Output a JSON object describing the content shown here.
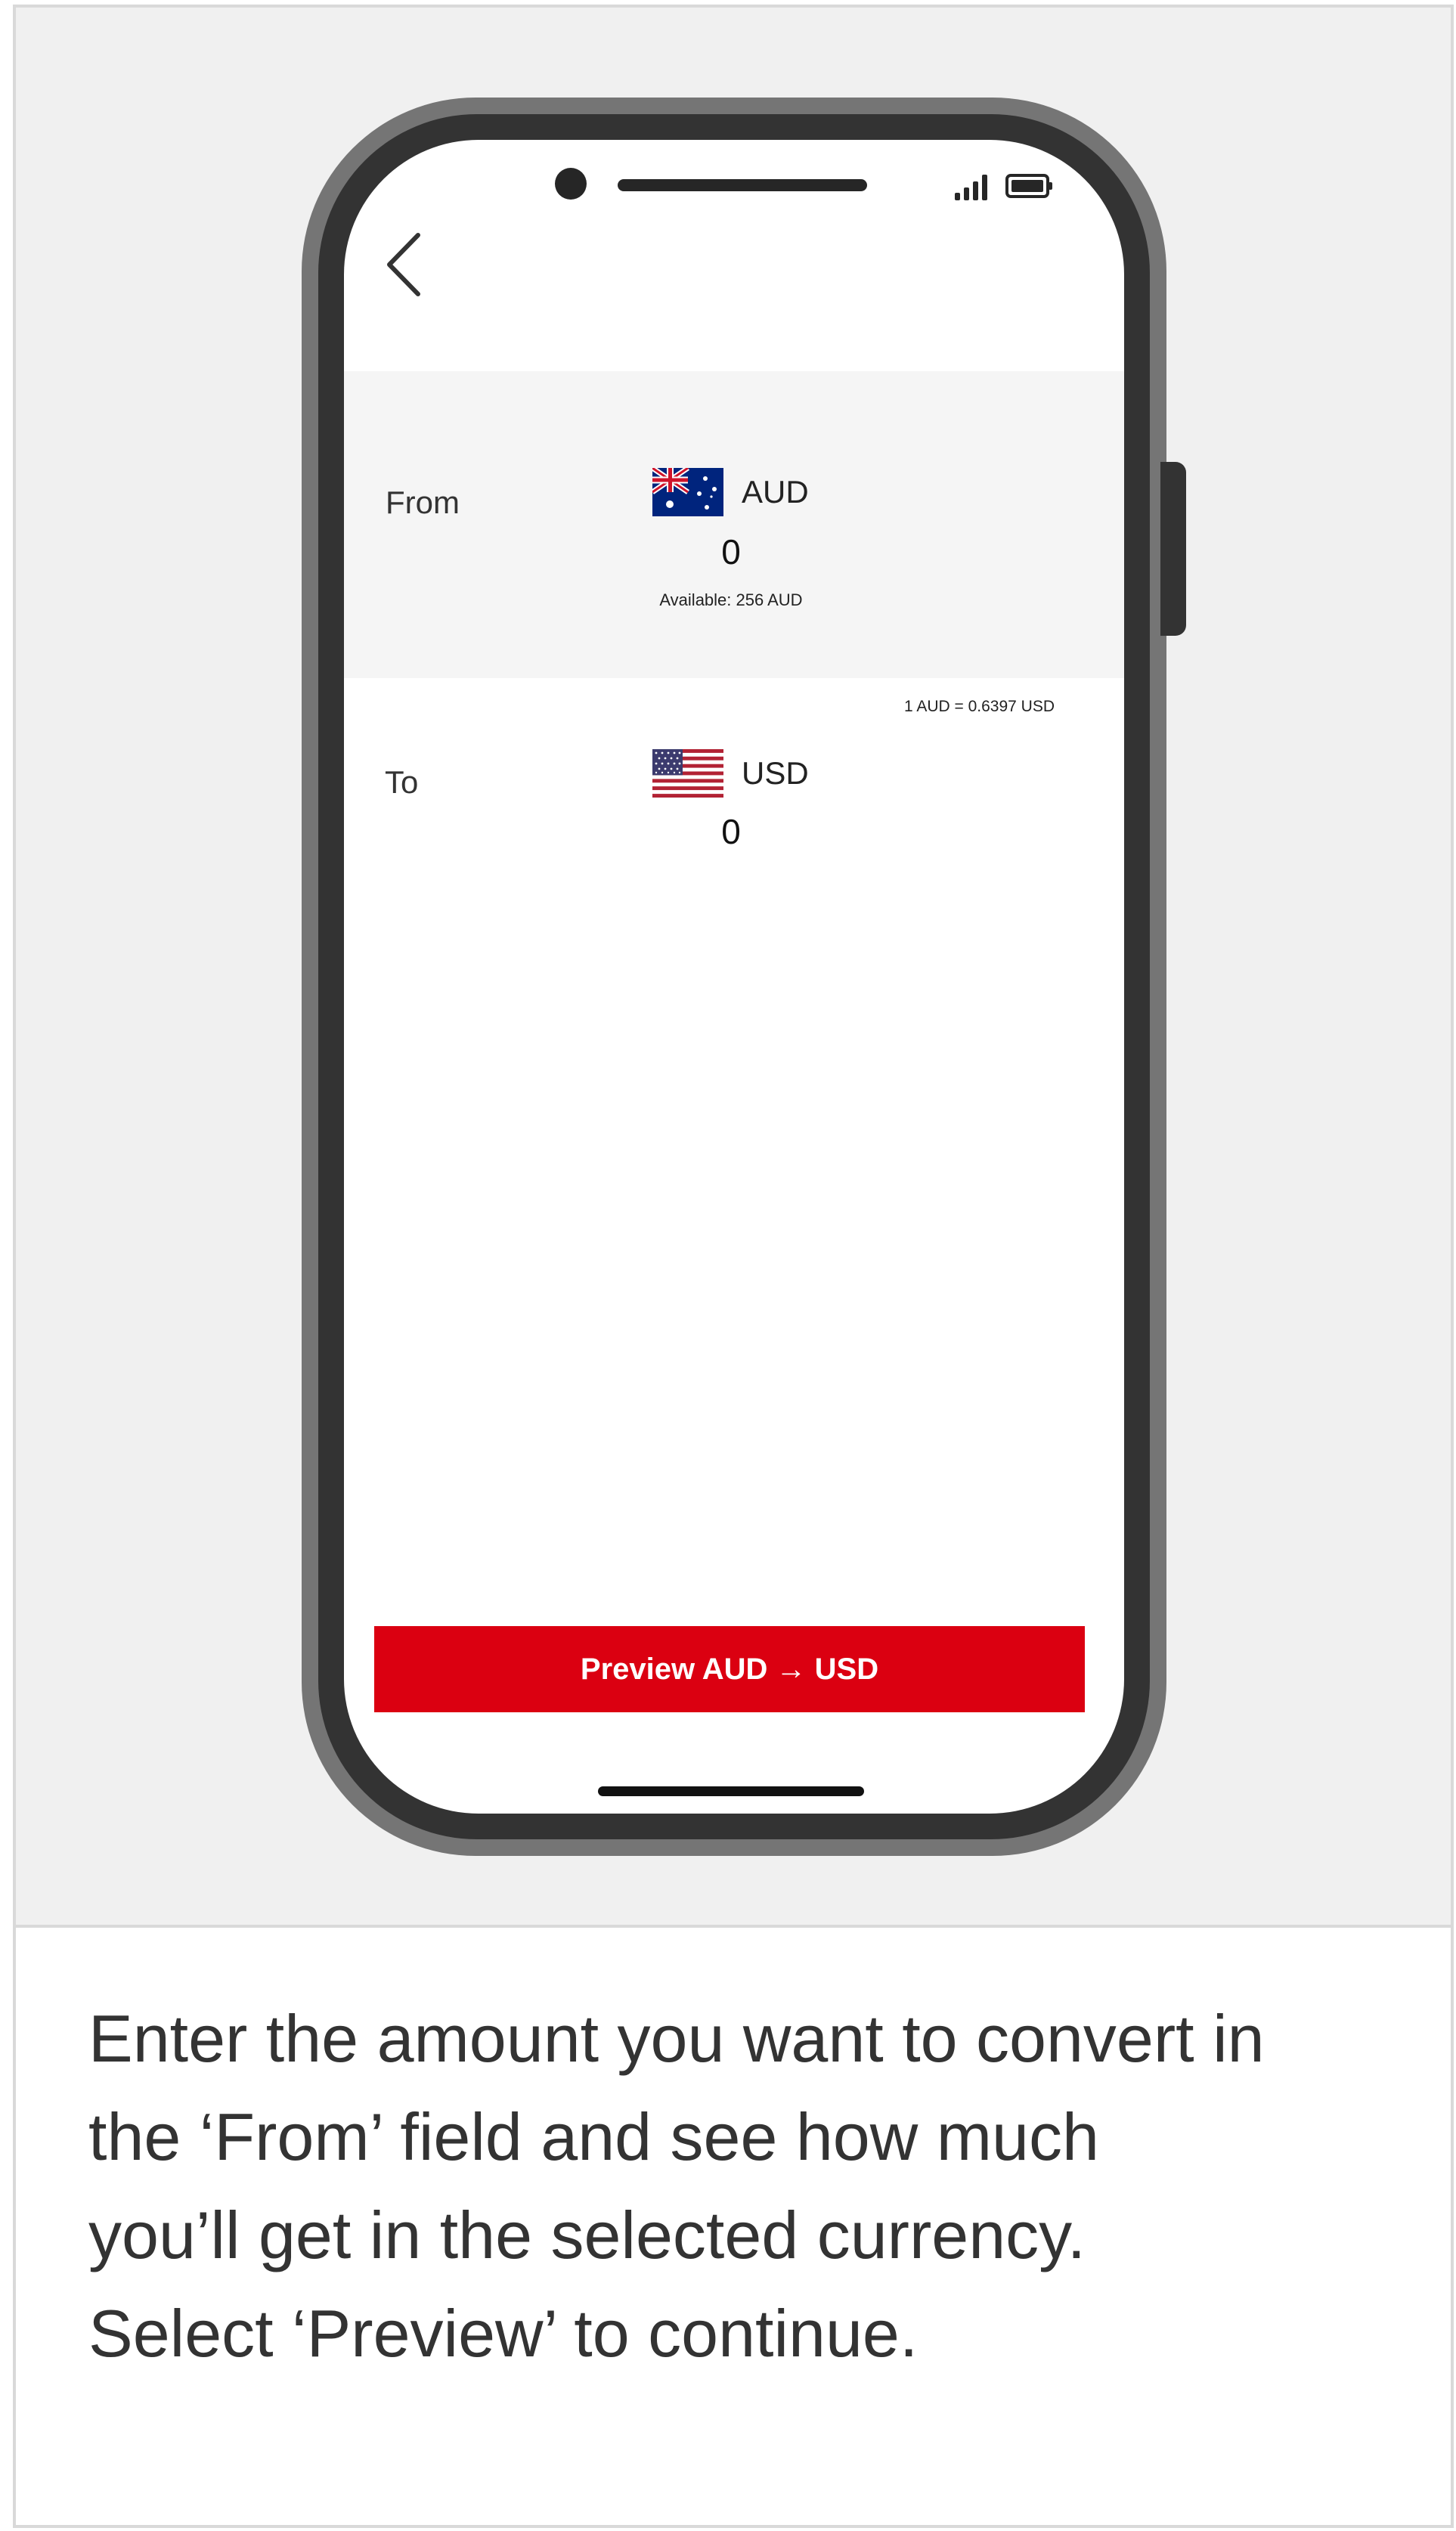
{
  "from": {
    "label": "From",
    "currency": "AUD",
    "amount": "0",
    "available": "Available: 256 AUD",
    "flag_icon": "australia-flag-icon"
  },
  "rate": "1 AUD = 0.6397 USD",
  "to": {
    "label": "To",
    "currency": "USD",
    "amount": "0",
    "flag_icon": "usa-flag-icon"
  },
  "preview_button": {
    "label": "Preview AUD → USD",
    "color": "#db0011"
  },
  "caption_lines": [
    "Enter the amount you want to convert in",
    "the ‘From’ field and see how much",
    "you’ll get in the selected currency.",
    "Select ‘Preview’ to continue."
  ]
}
